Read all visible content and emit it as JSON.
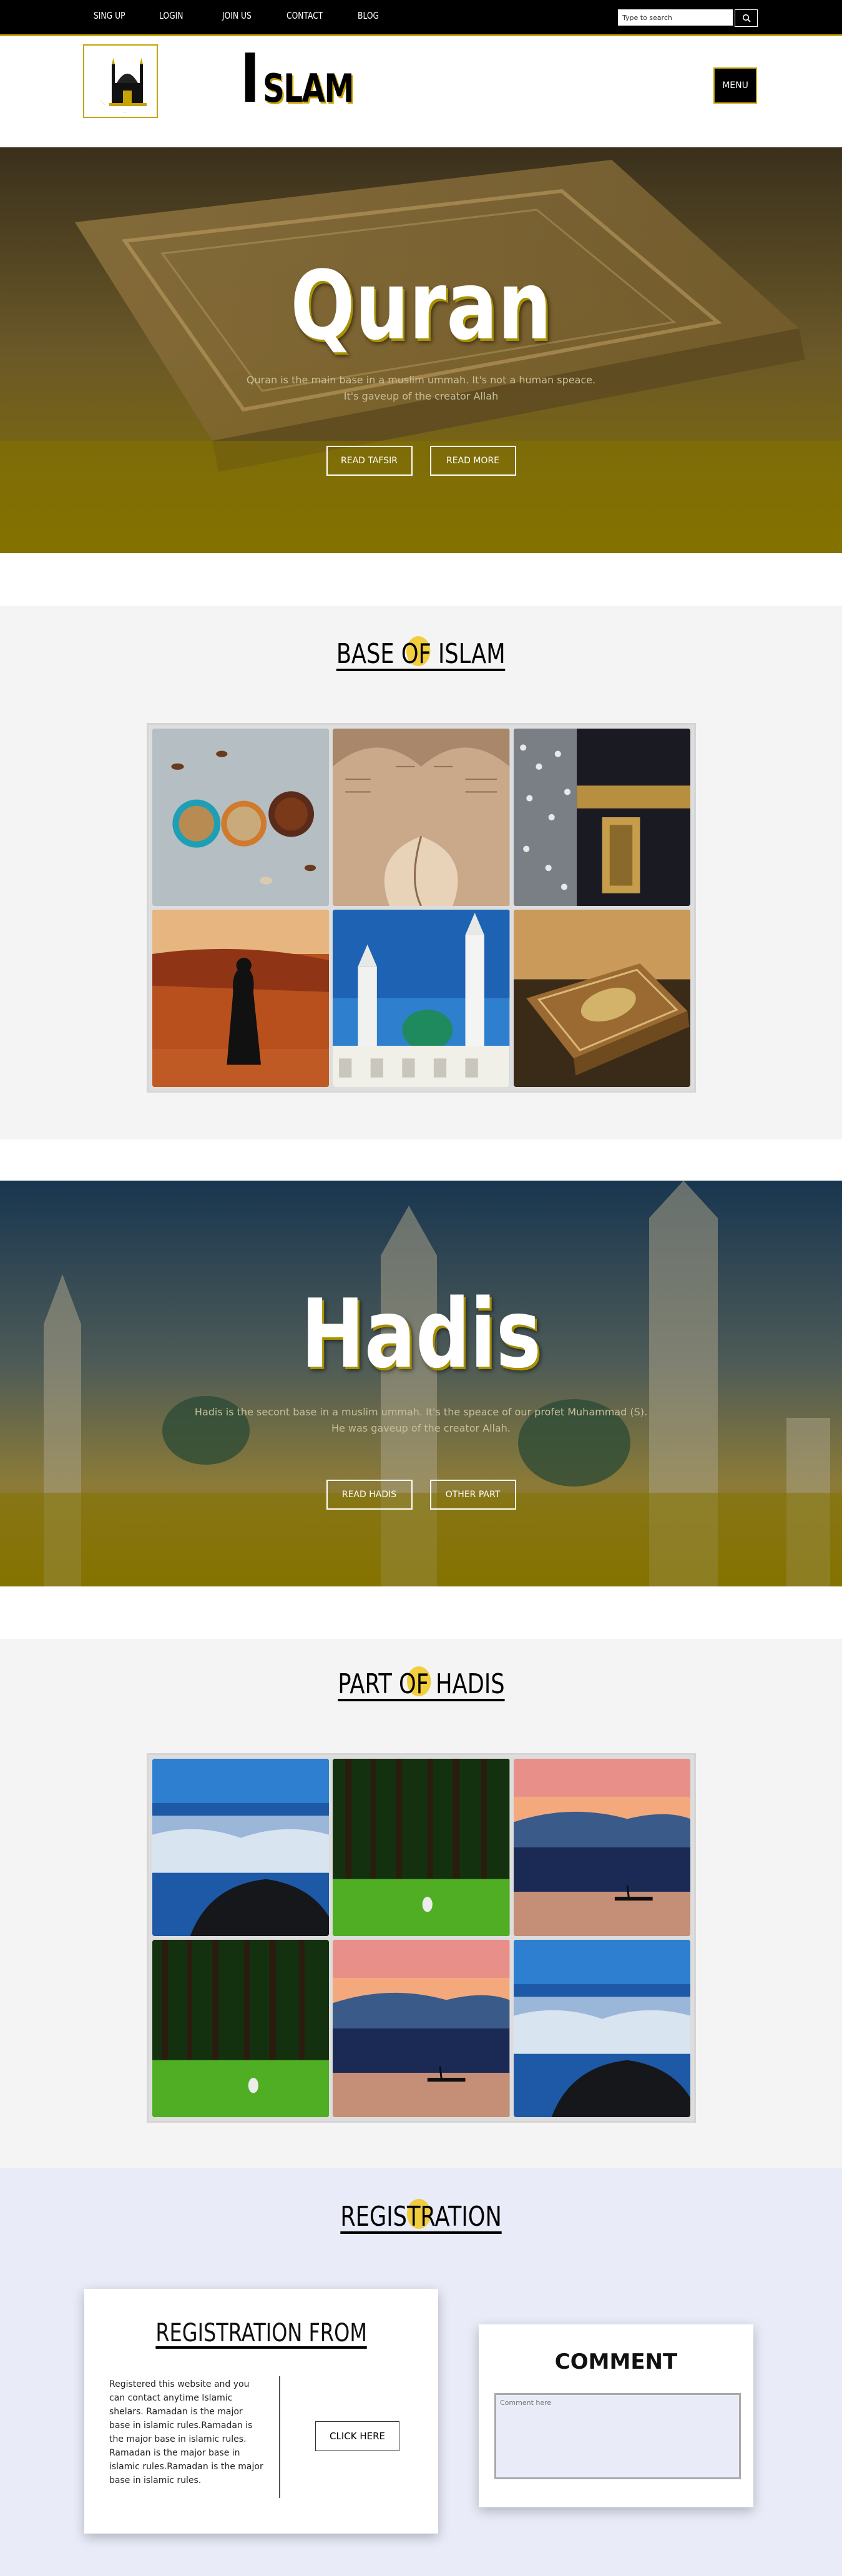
{
  "nav": {
    "items": [
      "SING UP",
      "LOGIN",
      "JOIN US",
      "CONTACT",
      "BLOG"
    ],
    "search_placeholder": "Type to search"
  },
  "header": {
    "brand_first": "I",
    "brand_rest": "SLAM",
    "menu_label": "MENU"
  },
  "hero_quran": {
    "title": "Quran",
    "line1": "Quran is the main base in a muslim ummah. It's not a human speace.",
    "line2": "It's gaveup of the creator Allah",
    "btn1": "READ TAFSIR",
    "btn2": "READ MORE"
  },
  "base_section": {
    "title": "BASE OF ISLAM"
  },
  "hero_hadis": {
    "title": "Hadis",
    "line1": "Hadis is the secont base in a muslim ummah. It's the speace of our profet Muhammad (S).",
    "line2": "He was gaveup of the creator Allah.",
    "btn1": "READ HADIS",
    "btn2": "OTHER PART"
  },
  "part_section": {
    "title": "PART OF HADIS"
  },
  "registration": {
    "title": "REGISTRATION",
    "form_title": "REGISTRATION FROM",
    "form_text": "Registered this website and you can contact anytime Islamic shelars. Ramadan is the major base in islamic rules.Ramadan is the major base in islamic rules. Ramadan is the major base in islamic rules.Ramadan is the major base in islamic rules.",
    "click_label": "CLICK HERE",
    "comment_title": "COMMENT",
    "comment_placeholder": "Comment here"
  },
  "colors": {
    "accent": "#c6a300",
    "topbar": "#000000",
    "section_bg": "#f4f4f4",
    "registration_bg": "#e9ecf8"
  }
}
